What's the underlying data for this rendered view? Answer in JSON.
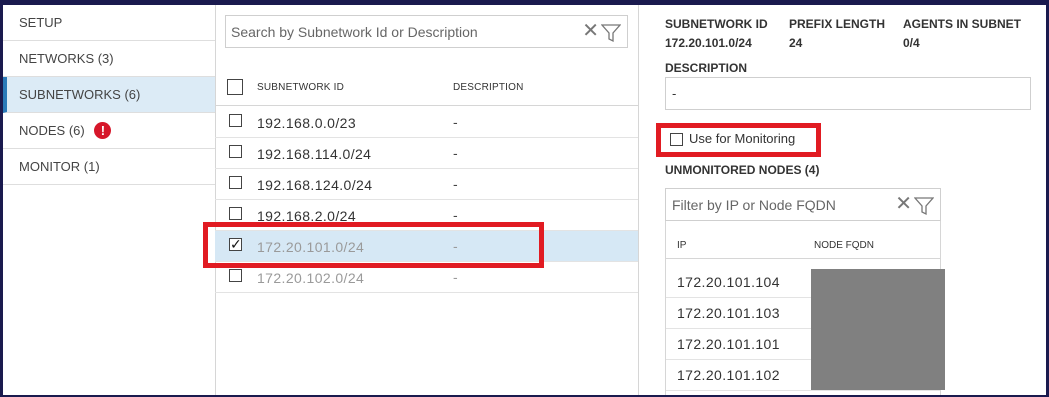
{
  "nav": {
    "items": [
      {
        "label": "SETUP",
        "active": false
      },
      {
        "label": "NETWORKS (3)",
        "active": false
      },
      {
        "label": "SUBNETWORKS (6)",
        "active": true
      },
      {
        "label": "NODES (6)",
        "active": false,
        "alert": "!"
      },
      {
        "label": "MONITOR (1)",
        "active": false
      }
    ]
  },
  "subnet_list": {
    "search_placeholder": "Search by Subnetwork Id or Description",
    "clear_icon": "close-icon",
    "filter_icon": "filter-icon",
    "columns": [
      "SUBNETWORK ID",
      "DESCRIPTION"
    ],
    "rows": [
      {
        "id": "192.168.0.0/23",
        "description": "-",
        "checked": false
      },
      {
        "id": "192.168.114.0/24",
        "description": "-",
        "checked": false
      },
      {
        "id": "192.168.124.0/24",
        "description": "-",
        "checked": false
      },
      {
        "id": "192.168.2.0/24",
        "description": "-",
        "checked": false
      },
      {
        "id": "172.20.101.0/24",
        "description": "-",
        "checked": true
      },
      {
        "id": "172.20.102.0/24",
        "description": "-",
        "checked": false
      }
    ]
  },
  "details": {
    "subnet_label": "SUBNETWORK ID",
    "subnet_value": "172.20.101.0/24",
    "prefix_label": "PREFIX LENGTH",
    "prefix_value": "24",
    "agents_label": "AGENTS IN SUBNET",
    "agents_value": "0/4",
    "description_label": "DESCRIPTION",
    "description_value": "-",
    "monitoring_label": "Use for Monitoring",
    "monitoring_checked": false,
    "unmonitored_title": "UNMONITORED NODES (4)",
    "filter_placeholder": "Filter by IP or Node FQDN",
    "columns": [
      "IP",
      "NODE FQDN"
    ],
    "nodes": [
      {
        "ip": "172.20.101.104"
      },
      {
        "ip": "172.20.101.103"
      },
      {
        "ip": "172.20.101.101"
      },
      {
        "ip": "172.20.101.102"
      }
    ]
  },
  "colors": {
    "highlight": "#e11b22",
    "active_nav": "#dcebf6",
    "selected_row": "#d6e8f5",
    "alert": "#d6172a",
    "frame": "#1a1a4e"
  }
}
